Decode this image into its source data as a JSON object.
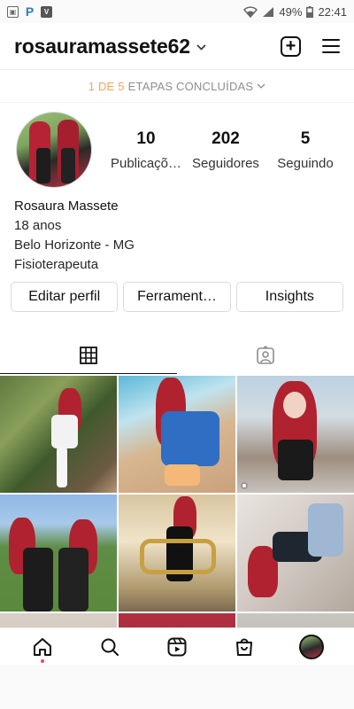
{
  "status_bar": {
    "left_icons": [
      "gallery-icon",
      "picsart-icon",
      "vimeo-icon"
    ],
    "wifi": "wifi-icon",
    "signal": "signal-icon",
    "battery": "49%",
    "time": "22:41"
  },
  "header": {
    "username": "rosauramassete62",
    "chevron": "⌄"
  },
  "steps": {
    "highlight": "1 DE 5",
    "rest": "ETAPAS CONCLUÍDAS"
  },
  "profile": {
    "stats": [
      {
        "value": "10",
        "label": "Publicaçõ…"
      },
      {
        "value": "202",
        "label": "Seguidores"
      },
      {
        "value": "5",
        "label": "Seguindo"
      }
    ],
    "name": "Rosaura Massete",
    "bio_lines": [
      "18 anos",
      "Belo Horizonte - MG",
      "Fisioterapeuta"
    ]
  },
  "buttons": {
    "edit": "Editar perfil",
    "tools": "Ferrament…",
    "insights": "Insights"
  },
  "tabs": {
    "grid": "grid-icon",
    "tagged": "tagged-icon"
  },
  "bottom_nav": [
    "home-icon",
    "search-icon",
    "reels-icon",
    "shop-icon",
    "profile-avatar"
  ],
  "colors": {
    "accent_orange": "#f5a35b",
    "notification_dot": "#ed4956"
  }
}
